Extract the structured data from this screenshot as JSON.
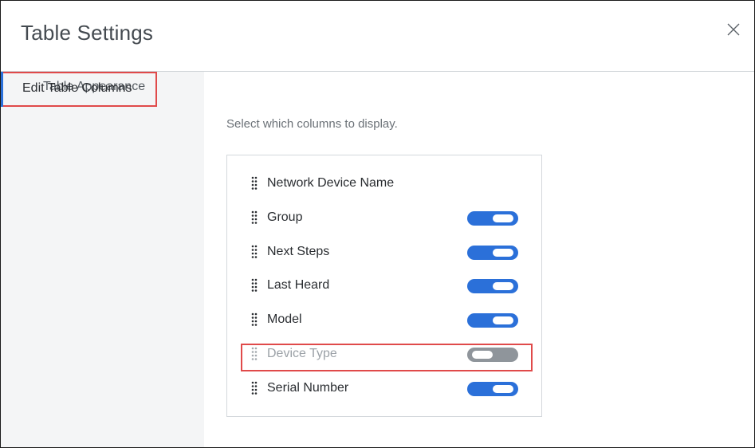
{
  "dialog": {
    "title": "Table Settings",
    "close_icon": "close-icon"
  },
  "sidebar": {
    "items": [
      {
        "label": "Table Appearance",
        "active": false
      },
      {
        "label": "Edit Table Columns",
        "active": true
      }
    ]
  },
  "main": {
    "helper_text": "Select which columns to display.",
    "columns": [
      {
        "label": "Network Device Name",
        "toggle": null
      },
      {
        "label": "Group",
        "toggle": "on"
      },
      {
        "label": "Next Steps",
        "toggle": "on"
      },
      {
        "label": "Last Heard",
        "toggle": "on"
      },
      {
        "label": "Model",
        "toggle": "on"
      },
      {
        "label": "Device Type",
        "toggle": "off"
      },
      {
        "label": "Serial Number",
        "toggle": "on"
      }
    ]
  },
  "colors": {
    "accent": "#2b70d9",
    "toggle_off": "#8f959b",
    "highlight": "#e04a4a"
  }
}
